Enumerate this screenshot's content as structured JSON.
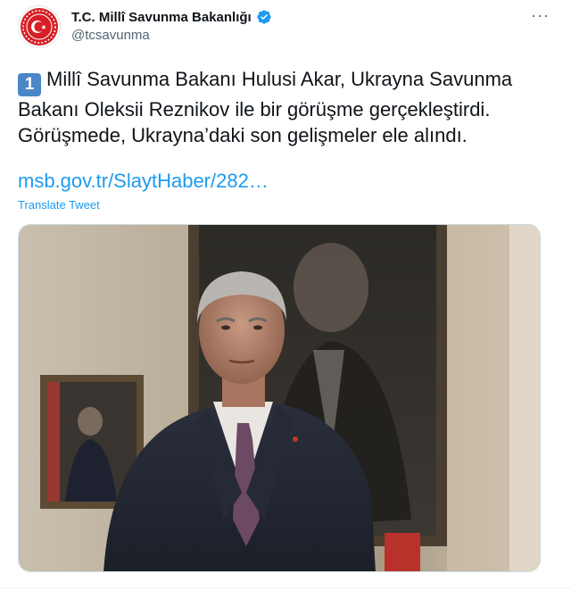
{
  "author": {
    "display_name": "T.C. Millî Savunma Bakanlığı",
    "handle": "@tcsavunma",
    "verified": true,
    "avatar_icon": "ministry-emblem-icon",
    "verified_icon": "verified-badge-icon"
  },
  "more_label": "···",
  "tweet": {
    "number_badge": "1",
    "text": "Millî Savunma Bakanı Hulusi Akar, Ukrayna Savunma Bakanı Oleksii Reznikov ile bir görüşme gerçekleştirdi. Görüşmede, Ukrayna’daki son gelişmeler ele alındı.",
    "link_text": "msb.gov.tr/SlaytHaber/282…",
    "translate_label": "Translate Tweet"
  },
  "colors": {
    "link": "#1d9bf0",
    "text": "#0f1419",
    "secondary": "#536471",
    "emblem_red": "#d61f26",
    "badge_blue": "#1d9bf0"
  }
}
